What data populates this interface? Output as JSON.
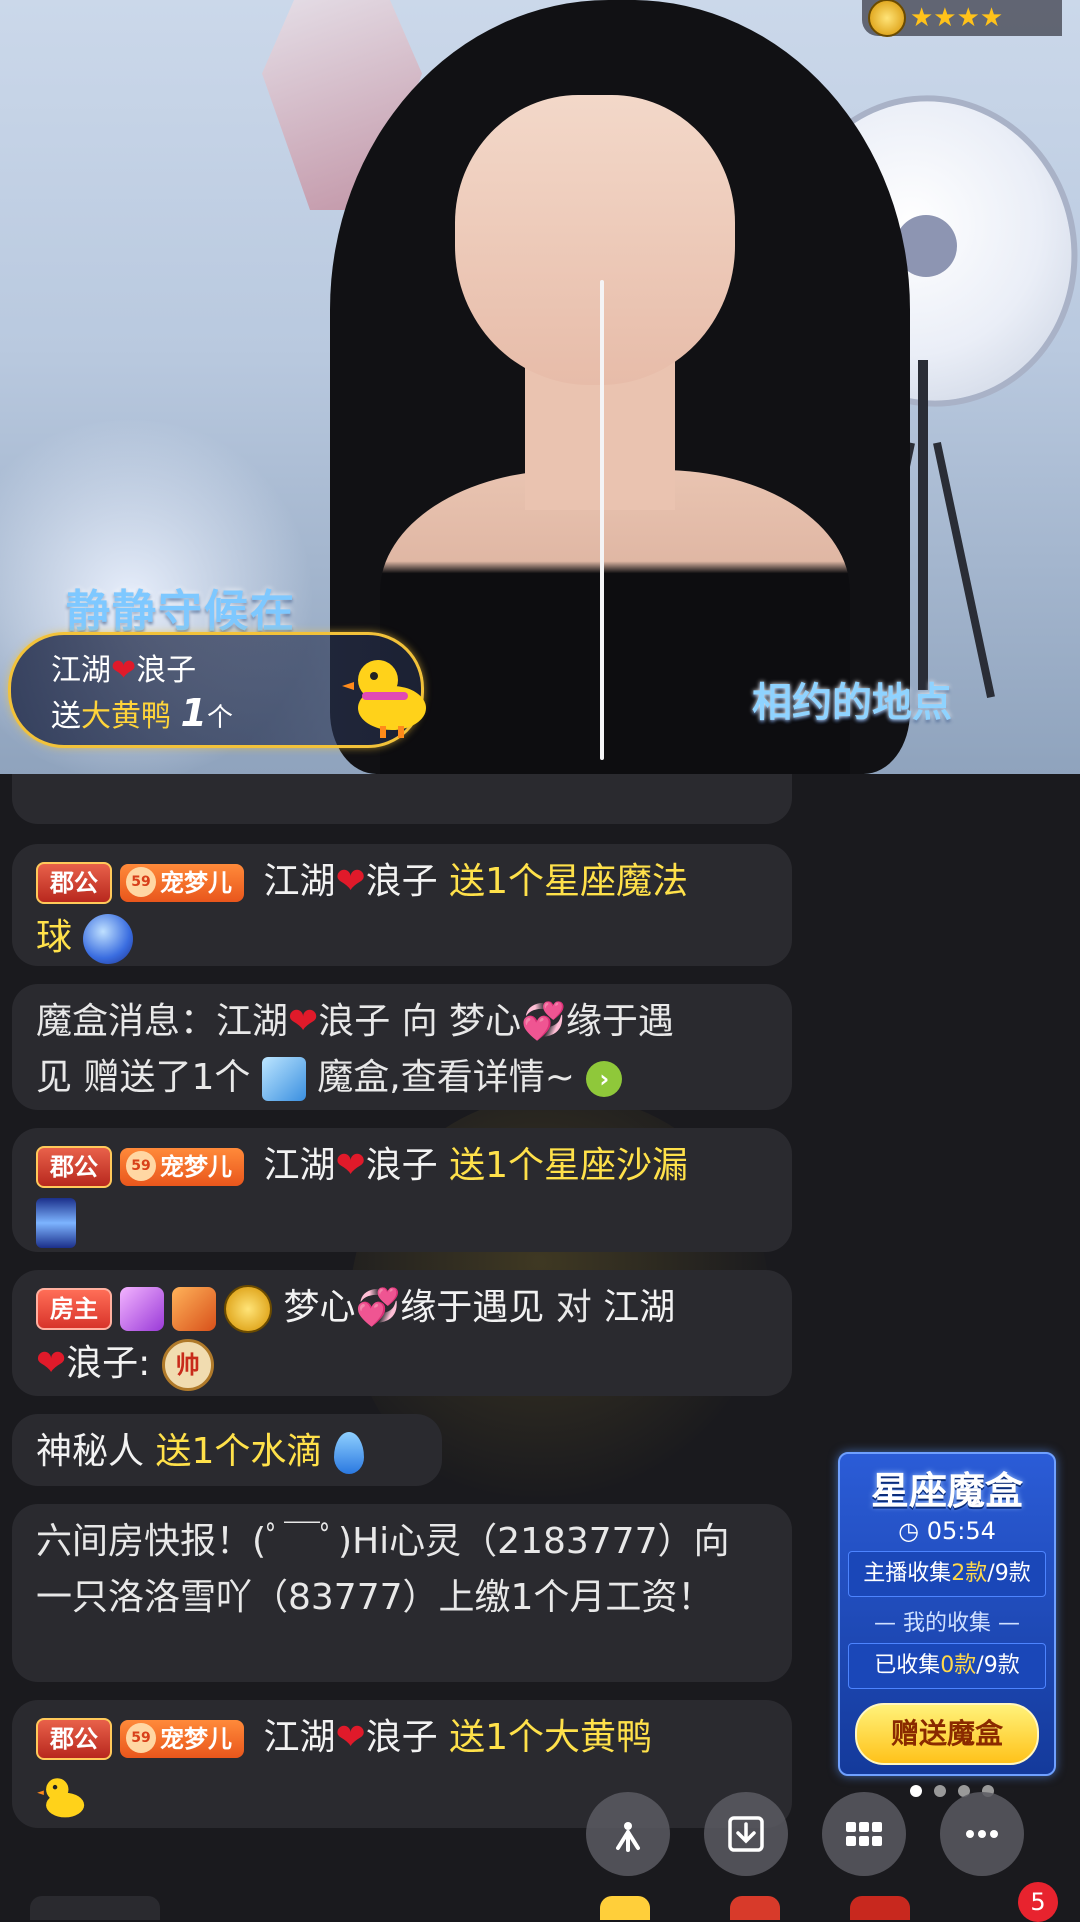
{
  "video": {
    "stars": "★★★★",
    "song_title": "静静守候在",
    "lyric": "相约的地点",
    "gift_toast": {
      "user": "江湖",
      "user_suffix": "浪子",
      "send": "送",
      "gift_name": "大黄鸭",
      "count": "1",
      "unit": "个"
    }
  },
  "chat": {
    "messages": [
      {
        "badge1": "郡公",
        "badge2_level": "59",
        "badge2": "宠梦儿",
        "user": "江湖",
        "user_suffix": "浪子",
        "action": "送1个星座魔法",
        "action_cont": "球"
      },
      {
        "text1": "魔盒消息：江湖",
        "text2": "浪子 向 梦心",
        "text3": "缘于遇",
        "text4": "见 赠送了1个",
        "text5": "魔盒,查看详情~"
      },
      {
        "badge1": "郡公",
        "badge2_level": "59",
        "badge2": "宠梦儿",
        "user": "江湖",
        "user_suffix": "浪子",
        "action": "送1个星座沙漏"
      },
      {
        "badge1": "房主",
        "user": "梦心",
        "user_suffix": "缘于遇见",
        "to": "对",
        "target": "江湖",
        "target_suffix": "浪子:",
        "chess": "帅"
      },
      {
        "user": "神秘人",
        "action": "送1个水滴"
      },
      {
        "text": " 六间房快报！(ﾟ￣ﾟ)Hi心灵（2183777）向 一只洛洛雪吖（83777）上缴1个月工资！"
      },
      {
        "badge1": "郡公",
        "badge2_level": "59",
        "badge2": "宠梦儿",
        "user": "江湖",
        "user_suffix": "浪子",
        "action": "送1个大黄鸭"
      }
    ]
  },
  "magic_box": {
    "title": "星座魔盒",
    "timer": "05:54",
    "host_collect_label": "主播收集",
    "host_collect_num": "2款",
    "host_collect_total": "/9款",
    "mine_label": "— 我的收集 —",
    "my_collect_label": "已收集",
    "my_collect_num": "0款",
    "my_collect_total": "/9款",
    "send_button": "赠送魔盒"
  },
  "controls": {
    "notification_count": "5"
  }
}
